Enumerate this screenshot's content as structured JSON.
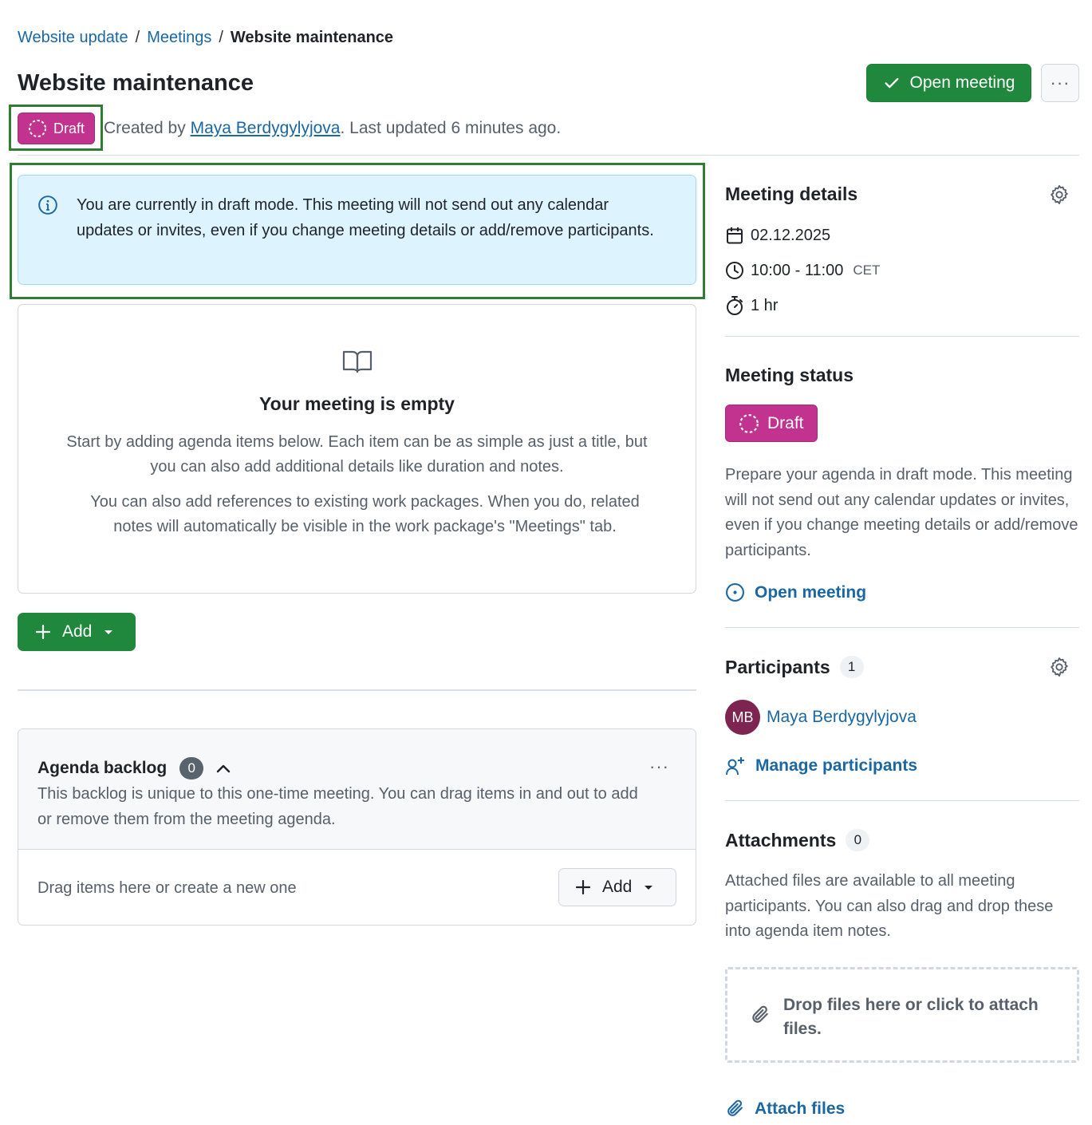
{
  "breadcrumb": {
    "project": "Website update",
    "section": "Meetings",
    "current": "Website maintenance",
    "separator": "/"
  },
  "header": {
    "title": "Website maintenance",
    "open_meeting_label": "Open meeting",
    "more_label": "···"
  },
  "meta": {
    "status_badge": "Draft",
    "created_by_prefix": "Created by",
    "author": "Maya Berdygylyjova",
    "last_updated": ". Last updated 6 minutes ago."
  },
  "banner": {
    "text": "You are currently in draft mode. This meeting will not send out any calendar updates or invites, even if you change meeting details or add/remove participants."
  },
  "empty_state": {
    "title": "Your meeting is empty",
    "paragraph1": "Start by adding agenda items below. Each item can be as simple as just a title, but you can also add additional details like duration and notes.",
    "paragraph2": "You can also add references to existing work packages. When you do, related notes will automatically be visible in the work package's \"Meetings\" tab."
  },
  "add_button_label": "Add",
  "backlog": {
    "title": "Agenda backlog",
    "count": "0",
    "description": "This backlog is unique to this one-time meeting. You can drag items in and out to add or remove them from the meeting agenda.",
    "hint": "Drag items here or create a new one",
    "add_label": "Add"
  },
  "sidebar": {
    "details": {
      "title": "Meeting details",
      "date": "02.12.2025",
      "time": "10:00 - 11:00",
      "timezone": "CET",
      "duration": "1 hr"
    },
    "status": {
      "title": "Meeting status",
      "badge": "Draft",
      "description": "Prepare your agenda in draft mode. This meeting will not send out any calendar updates or invites, even if you change meeting details or add/remove participants.",
      "action": "Open meeting"
    },
    "participants": {
      "title": "Participants",
      "count": "1",
      "items": [
        {
          "initials": "MB",
          "name": "Maya Berdygylyjova"
        }
      ],
      "manage": "Manage participants"
    },
    "attachments": {
      "title": "Attachments",
      "count": "0",
      "description": "Attached files are available to all meeting participants. You can also drag and drop these into agenda item notes.",
      "dropzone": "Drop files here or click to attach files.",
      "attach": "Attach files"
    }
  },
  "colors": {
    "primary_green": "#1f883d",
    "draft_magenta": "#c2338f",
    "link_blue": "#1a67a3",
    "info_bg": "#ddf4ff",
    "avatar": "#7d2450"
  }
}
